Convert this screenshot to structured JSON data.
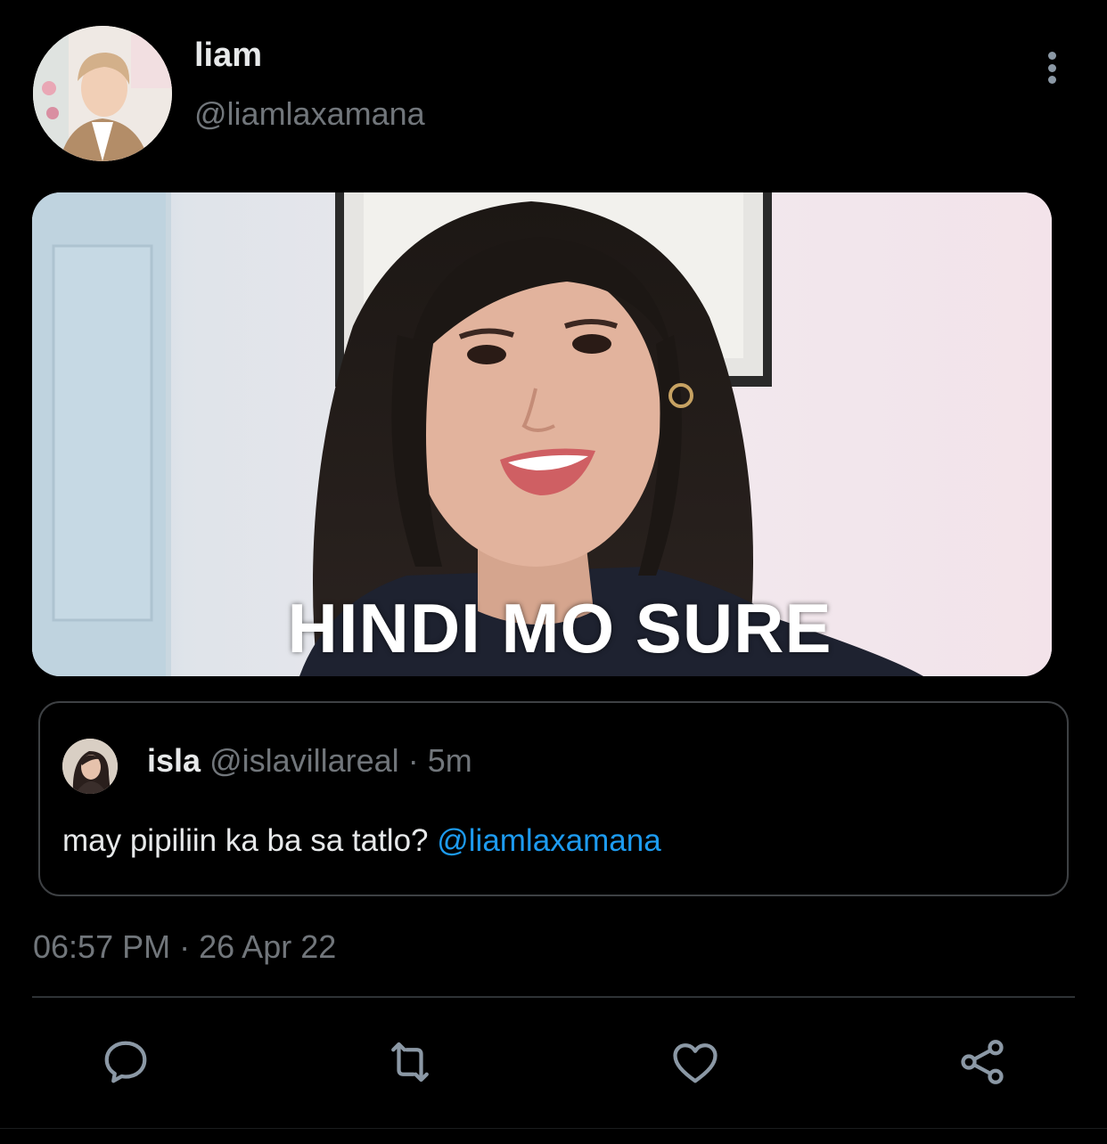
{
  "author": {
    "display_name": "liam",
    "handle": "@liamlaxamana"
  },
  "media": {
    "caption": "HINDI MO SURE"
  },
  "quoted_tweet": {
    "display_name": "isla",
    "handle": "@islavillareal",
    "separator": "·",
    "time_ago": "5m",
    "text": "may pipiliin ka ba sa tatlo? ",
    "mention": "@liamlaxamana"
  },
  "timestamp": {
    "time": "06:57 PM",
    "separator": "·",
    "date": "26 Apr 22"
  },
  "actions": {
    "reply_icon": "comment-icon",
    "retweet_icon": "retweet-icon",
    "like_icon": "heart-icon",
    "share_icon": "share-icon"
  },
  "colors": {
    "background": "#000000",
    "primary_text": "#e7e9ea",
    "secondary_text": "#71767b",
    "link": "#1d9bf0",
    "border": "#3e4144"
  }
}
